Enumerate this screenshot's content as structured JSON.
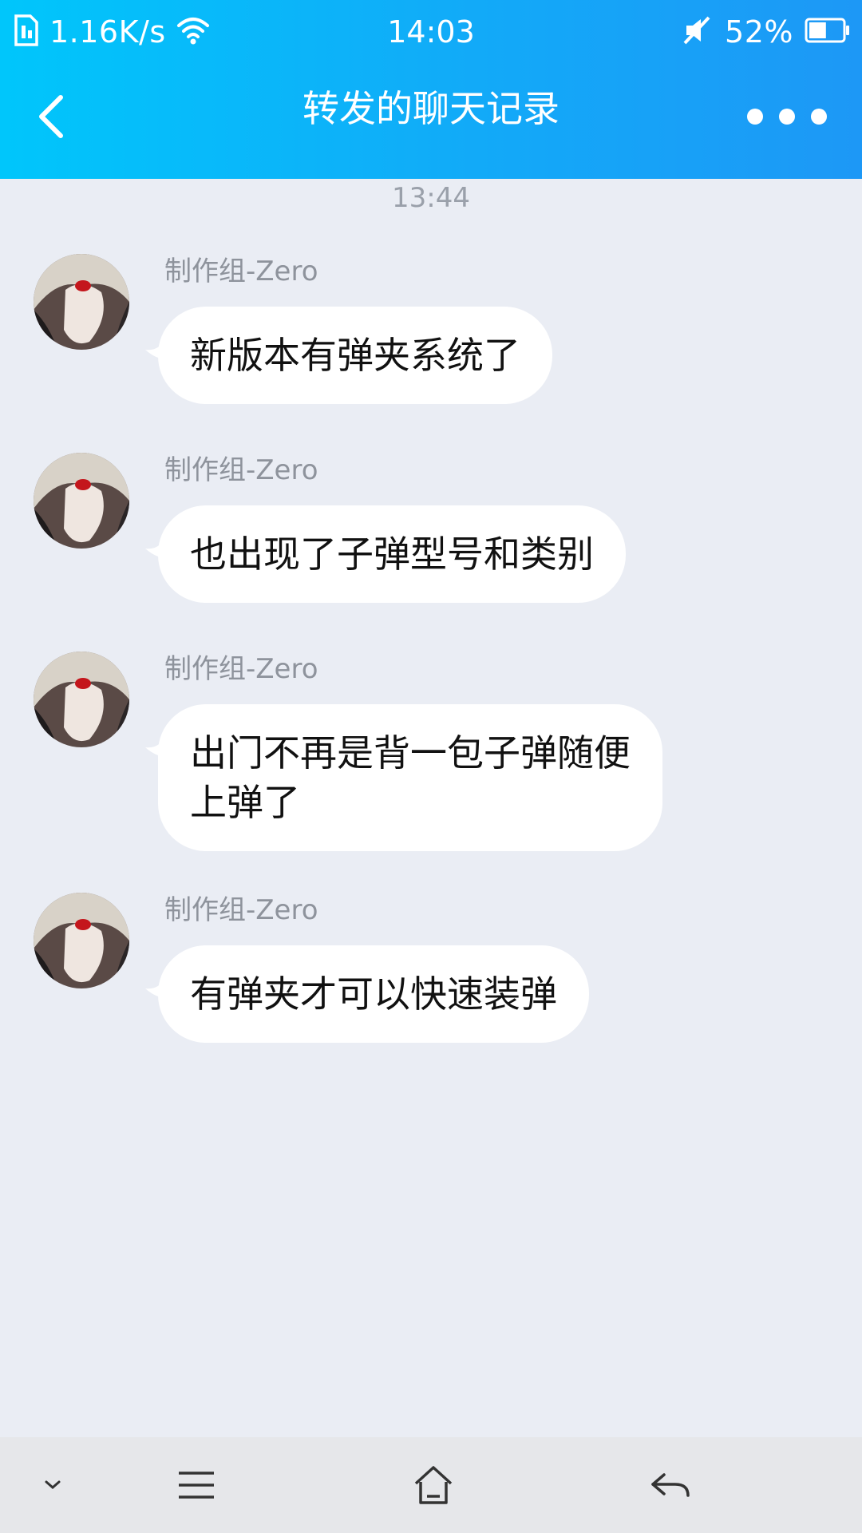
{
  "status_bar": {
    "network_speed": "1.16K/s",
    "time": "14:03",
    "battery_percent": "52%",
    "battery_level": 0.52,
    "icons": [
      "sim-card-icon",
      "wifi-icon",
      "silent-mode-icon",
      "battery-icon"
    ]
  },
  "header": {
    "title": "转发的聊天记录",
    "back_icon": "chevron-left-icon",
    "more_icon": "more-dots-icon"
  },
  "timestamp": "13:44",
  "messages": [
    {
      "sender": "制作组-Zero",
      "lines": [
        "新版本有弹夹系统了"
      ]
    },
    {
      "sender": "制作组-Zero",
      "lines": [
        "也出现了子弹型号和类别"
      ]
    },
    {
      "sender": "制作组-Zero",
      "lines": [
        "出门不再是背一包子弹随便",
        "上弹了"
      ]
    },
    {
      "sender": "制作组-Zero",
      "lines": [
        "有弹夹才可以快速装弹"
      ]
    }
  ],
  "bottom_nav": [
    "chevron-down-icon",
    "menu-icon",
    "home-icon",
    "back-arrow-icon"
  ],
  "colors": {
    "header_gradient_start": "#00c6fb",
    "header_gradient_end": "#1d98f6",
    "background": "#eaedf4",
    "bubble": "#ffffff",
    "sender_text": "#8e939c"
  }
}
